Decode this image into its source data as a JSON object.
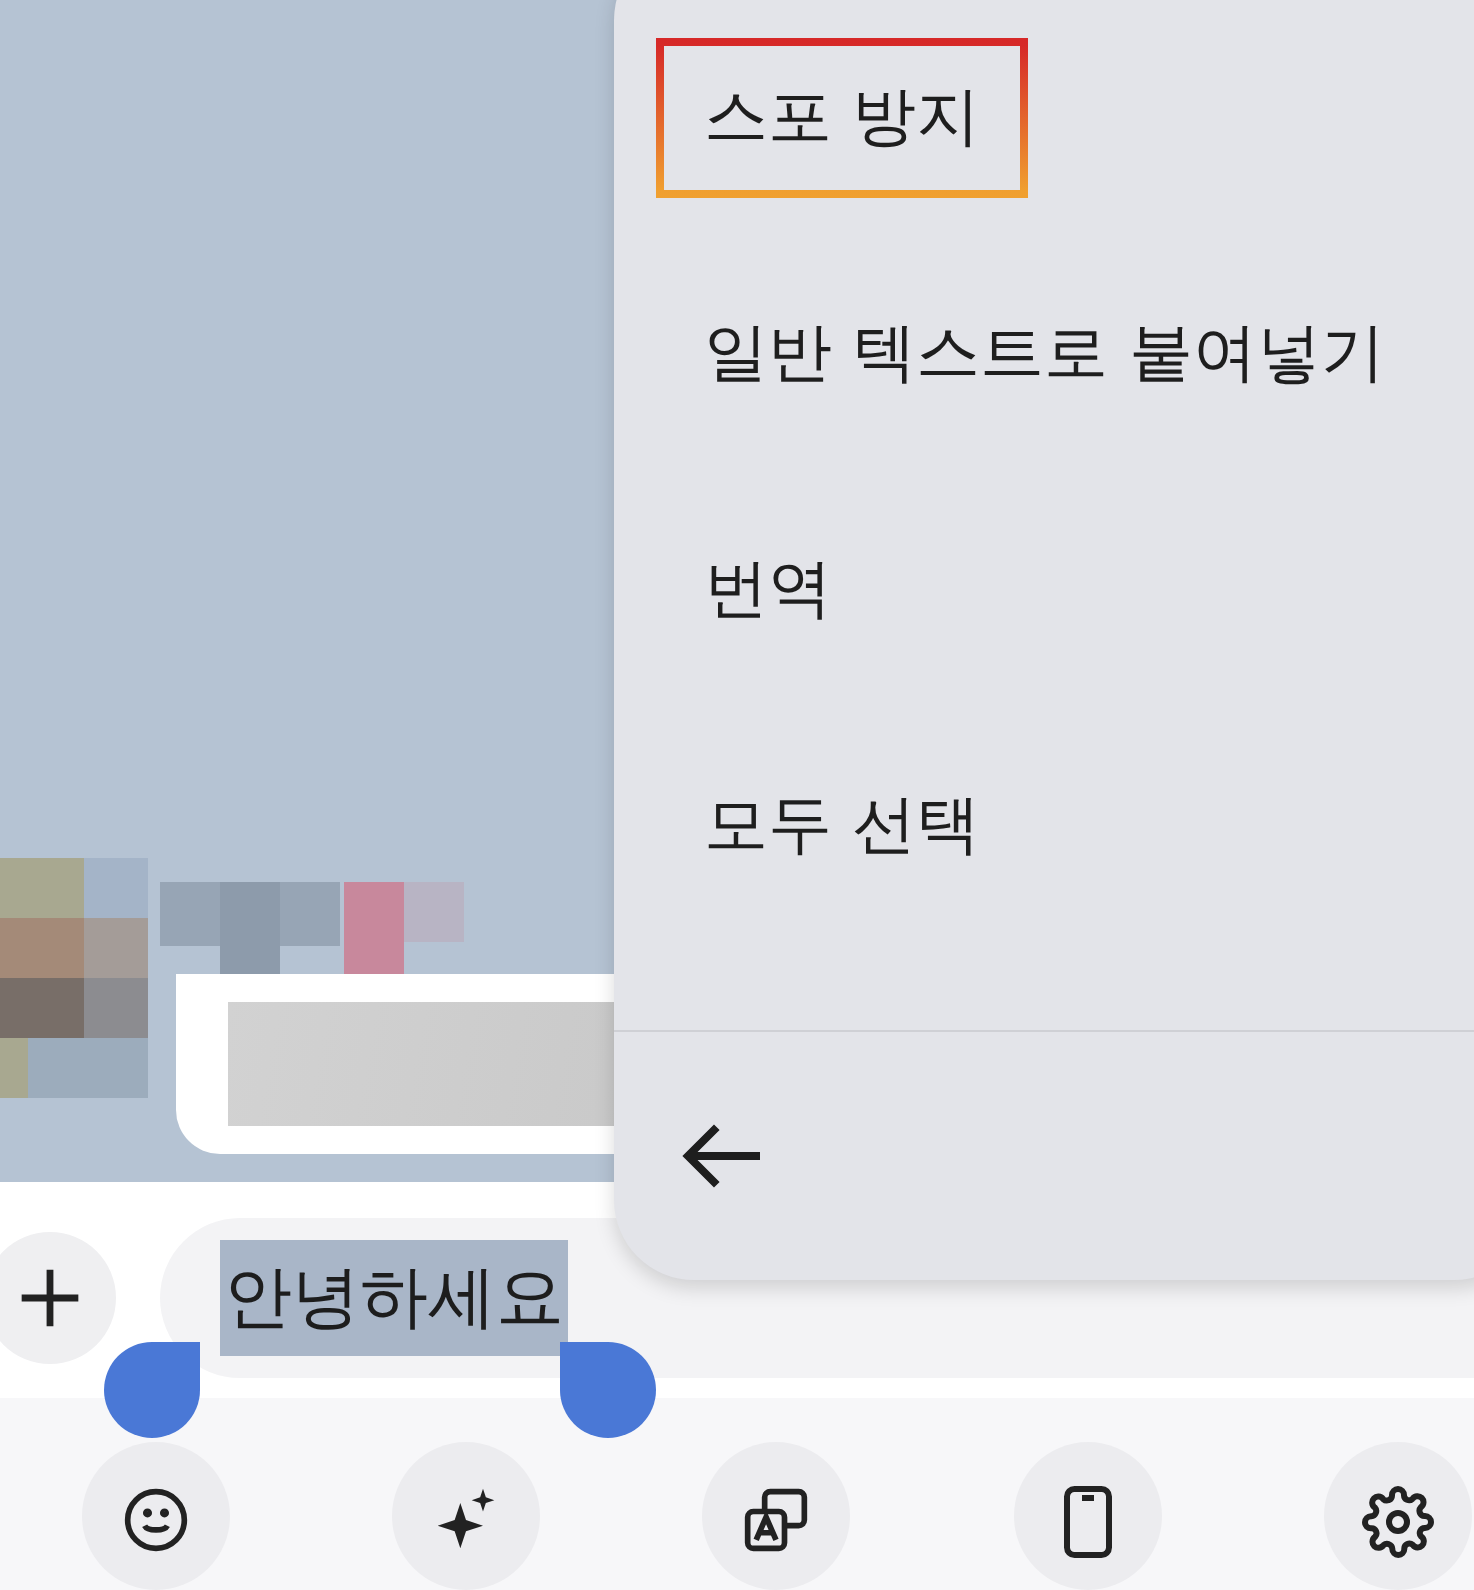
{
  "menu": {
    "items": [
      {
        "label": "스포 방지",
        "highlighted": true
      },
      {
        "label": "일반 텍스트로 붙여넣기",
        "highlighted": false
      },
      {
        "label": "번역",
        "highlighted": false
      },
      {
        "label": "모두 선택",
        "highlighted": false
      }
    ]
  },
  "input": {
    "value": "안녕하세요",
    "selected": true
  },
  "toolbar": [
    {
      "kind": "emoji"
    },
    {
      "kind": "sparkle"
    },
    {
      "kind": "translate"
    },
    {
      "kind": "phone"
    },
    {
      "kind": "settings"
    }
  ]
}
